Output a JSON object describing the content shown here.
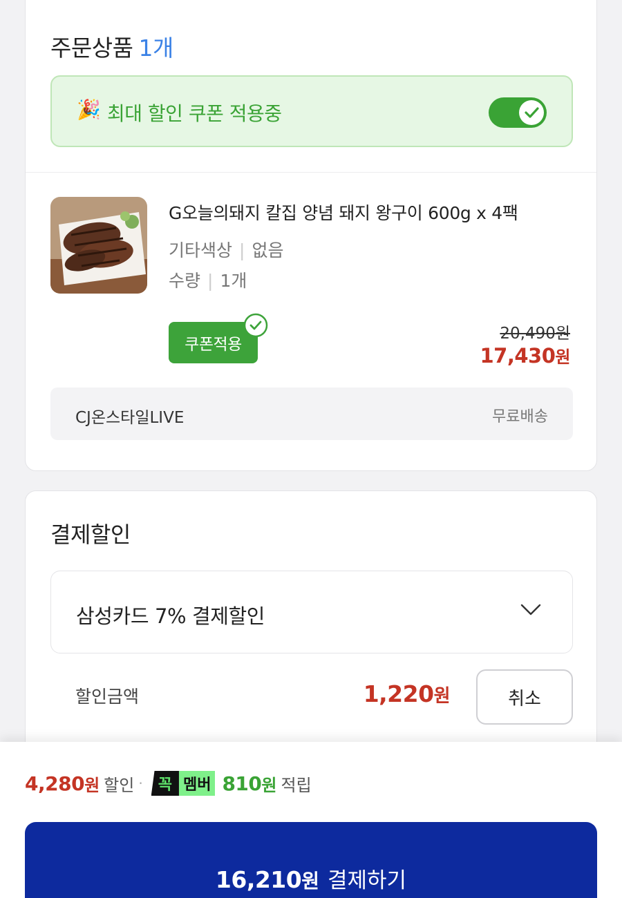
{
  "order": {
    "title": "주문상품",
    "count": "1개",
    "coupon_banner": {
      "text": "최대 할인 쿠폰 적용중",
      "party_icon": "🎉",
      "toggle_on": true
    },
    "product": {
      "image_icon": "grilled-pork-photo",
      "name": "G오늘의돼지 칼집 양념 돼지 왕구이 600g x 4팩",
      "options": [
        {
          "label": "기타색상",
          "value": "없음"
        },
        {
          "label": "수량",
          "value": "1개"
        }
      ],
      "coupon_badge": "쿠폰적용",
      "original_price": "20,490원",
      "sale_price": "17,430",
      "sale_unit": "원"
    },
    "seller": {
      "name": "CJ온스타일LIVE",
      "shipping": "무료배송"
    }
  },
  "payment_discount": {
    "title": "결제할인",
    "selected": "삼성카드 7% 결제할인",
    "discount_label": "할인금액",
    "discount_amount": "1,220",
    "discount_unit": "원",
    "cancel_label": "취소"
  },
  "bottom": {
    "discount_total": "4,280",
    "discount_unit": "원",
    "discount_word": "할인",
    "dot": "·",
    "member_badge_a": "꼭",
    "member_badge_b": "멤버",
    "points": "810",
    "points_unit": "원",
    "points_word": "적립",
    "pay_amount": "16,210",
    "pay_unit": "원",
    "pay_action": "결제하기"
  },
  "colors": {
    "accent_blue": "#3b82e6",
    "green": "#3aa335",
    "red": "#c43424",
    "pay_button": "#0d2a9e"
  }
}
